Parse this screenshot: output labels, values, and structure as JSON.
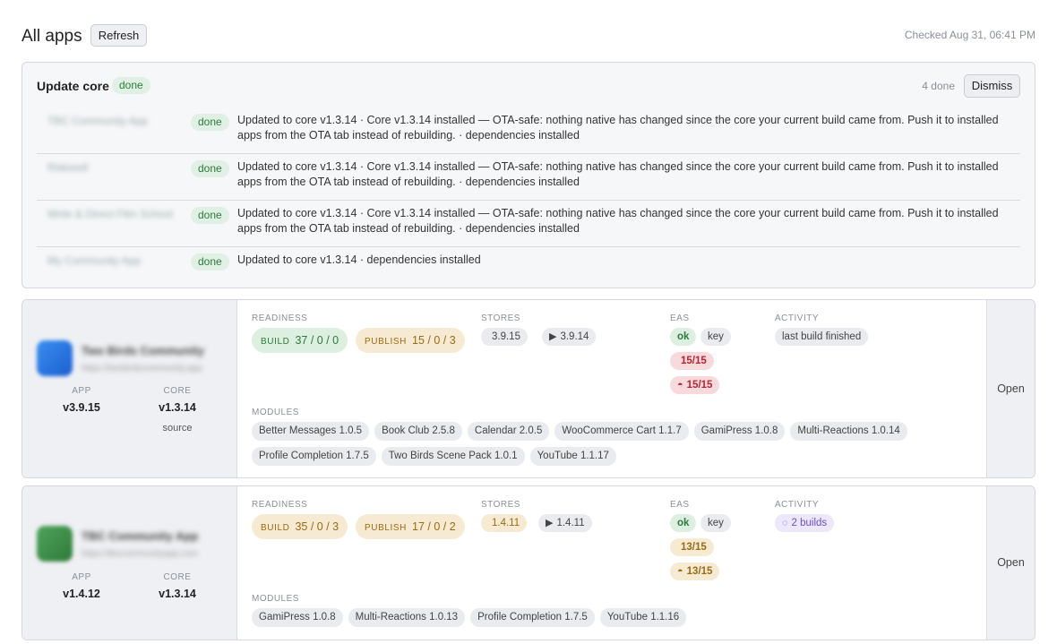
{
  "header": {
    "title": "All apps",
    "refresh_label": "Refresh",
    "checked": "Checked Aug 31, 06:41 PM"
  },
  "update_core": {
    "title": "Update core",
    "status": "done",
    "done_count": "4 done",
    "dismiss_label": "Dismiss",
    "rows": [
      {
        "name": "TBC Community App",
        "status": "done",
        "message": "Updated to core v1.3.14 · Core v1.3.14 installed — OTA-safe: nothing native has changed since the core your current build came from. Push it to installed apps from the OTA tab instead of rebuilding. · dependencies installed"
      },
      {
        "name": "Ridewell",
        "status": "done",
        "message": "Updated to core v1.3.14 · Core v1.3.14 installed — OTA-safe: nothing native has changed since the core your current build came from. Push it to installed apps from the OTA tab instead of rebuilding. · dependencies installed"
      },
      {
        "name": "Write & Direct Film School",
        "status": "done",
        "message": "Updated to core v1.3.14 · Core v1.3.14 installed — OTA-safe: nothing native has changed since the core your current build came from. Push it to installed apps from the OTA tab instead of rebuilding. · dependencies installed"
      },
      {
        "name": "My Community App",
        "status": "done",
        "message": "Updated to core v1.3.14 · dependencies installed"
      }
    ]
  },
  "labels": {
    "app": "APP",
    "core": "CORE",
    "readiness": "READINESS",
    "stores": "STORES",
    "eas": "EAS",
    "activity": "ACTIVITY",
    "modules": "MODULES",
    "build": "BUILD",
    "publish": "PUBLISH",
    "open": "Open"
  },
  "apps": [
    {
      "name": "Two Birds Community",
      "url": "https://twobirdscommunity.app",
      "app_version": "v3.9.15",
      "core_version": "v1.3.14",
      "core_sub": "source",
      "build": "37 / 0 / 0",
      "publish": "15 / 0 / 3",
      "store_ios": "3.9.15",
      "store_android": "3.9.14",
      "eas_status": "ok",
      "eas_key": "key",
      "eas_ios": "15/15",
      "eas_android": "15/15",
      "activity": "last build finished",
      "modules": [
        "Better Messages 1.0.5",
        "Book Club 2.5.8",
        "Calendar 2.0.5",
        "WooCommerce Cart 1.1.7",
        "GamiPress 1.0.8",
        "Multi-Reactions 1.0.14",
        "Profile Completion 1.7.5",
        "Two Birds Scene Pack 1.0.1",
        "YouTube 1.1.17"
      ],
      "icon_color": "#1a73e8"
    },
    {
      "name": "TBC Community App",
      "url": "https://tbccommunityapp.com",
      "app_version": "v1.4.12",
      "core_version": "v1.3.14",
      "build": "35 / 0 / 3",
      "publish": "17 / 0 / 2",
      "store_ios": "1.4.11",
      "store_android": "1.4.11",
      "eas_status": "ok",
      "eas_key": "key",
      "eas_ios": "13/15",
      "eas_android": "13/15",
      "activity": "2 builds",
      "modules": [
        "GamiPress 1.0.8",
        "Multi-Reactions 1.0.13",
        "Profile Completion 1.7.5",
        "YouTube 1.1.16"
      ],
      "icon_color": "#3e8e4a"
    }
  ]
}
